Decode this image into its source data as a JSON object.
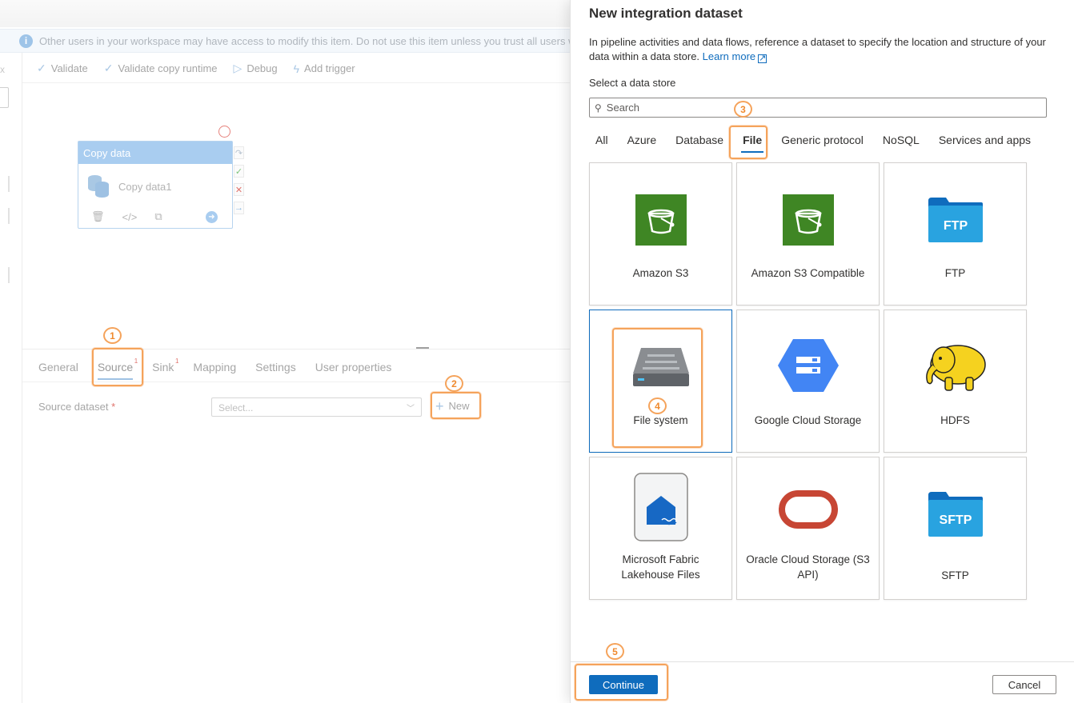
{
  "background": {
    "info_bar": {
      "icon": "info-icon",
      "text": "Other users in your workspace may have access to modify this item. Do not use this item unless you trust all users w"
    },
    "left_rail": {
      "close_glyph": "x"
    },
    "toolbar": {
      "validate": "Validate",
      "validate_runtime": "Validate copy runtime",
      "debug": "Debug",
      "add_trigger": "Add trigger"
    },
    "activity": {
      "header": "Copy data",
      "name": "Copy data1"
    },
    "bottom_tabs": [
      {
        "label": "General",
        "badge": ""
      },
      {
        "label": "Source",
        "badge": "1"
      },
      {
        "label": "Sink",
        "badge": "1"
      },
      {
        "label": "Mapping",
        "badge": ""
      },
      {
        "label": "Settings",
        "badge": ""
      },
      {
        "label": "User properties",
        "badge": ""
      }
    ],
    "source_dataset": {
      "label": "Source dataset",
      "required_mark": "*",
      "placeholder": "Select...",
      "new_label": "New"
    }
  },
  "panel": {
    "title": "New integration dataset",
    "description": "In pipeline activities and data flows, reference a dataset to specify the location and structure of your data within a data store.",
    "learn_more": "Learn more",
    "select_label": "Select a data store",
    "search_placeholder": "Search",
    "category_tabs": [
      "All",
      "Azure",
      "Database",
      "File",
      "Generic protocol",
      "NoSQL",
      "Services and apps"
    ],
    "active_category": "File",
    "tiles": [
      {
        "label": "Amazon S3",
        "icon": "amazon-s3-icon"
      },
      {
        "label": "Amazon S3 Compatible",
        "icon": "amazon-s3-compatible-icon"
      },
      {
        "label": "FTP",
        "icon": "ftp-folder-icon",
        "icon_text": "FTP"
      },
      {
        "label": "File system",
        "icon": "file-system-icon"
      },
      {
        "label": "Google Cloud Storage",
        "icon": "google-cloud-storage-icon"
      },
      {
        "label": "HDFS",
        "icon": "hadoop-elephant-icon"
      },
      {
        "label": "Microsoft Fabric Lakehouse Files",
        "icon": "fabric-lakehouse-icon"
      },
      {
        "label": "Oracle Cloud Storage (S3 API)",
        "icon": "oracle-icon"
      },
      {
        "label": "SFTP",
        "icon": "sftp-folder-icon",
        "icon_text": "SFTP"
      }
    ],
    "selected_tile": "File system",
    "continue_label": "Continue",
    "cancel_label": "Cancel"
  },
  "annotations": [
    "1",
    "2",
    "3",
    "4",
    "5"
  ],
  "colors": {
    "accent": "#0f6cbd",
    "annotation": "#f5a35b",
    "aws_green": "#3f8624",
    "gcs_blue": "#4285f4",
    "oracle_red": "#c74634",
    "folder_blue": "#29a3e0"
  }
}
